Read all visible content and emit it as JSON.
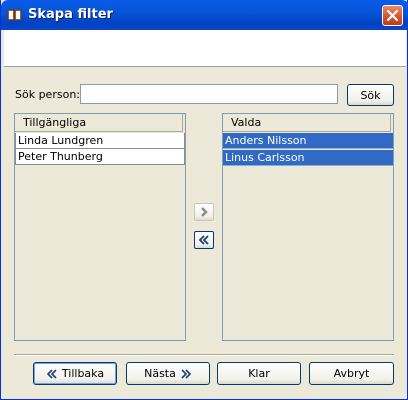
{
  "window": {
    "title": "Skapa filter",
    "accent": "#0054e3",
    "selection_color": "#316ac5"
  },
  "search": {
    "label": "Sök person:",
    "value": "",
    "placeholder": "",
    "button_label": "Sök"
  },
  "available": {
    "header": "Tillgängliga",
    "items": [
      "Linda Lundgren",
      "Peter Thunberg"
    ]
  },
  "selected": {
    "header": "Valda",
    "items": [
      "Anders Nilsson",
      "Linus Carlsson"
    ]
  },
  "transfer": {
    "add_icon": "chevron-right-icon",
    "remove_icon": "double-chevron-left-icon"
  },
  "footer": {
    "back_label": "Tillbaka",
    "next_label": "Nästa",
    "done_label": "Klar",
    "cancel_label": "Avbryt"
  }
}
